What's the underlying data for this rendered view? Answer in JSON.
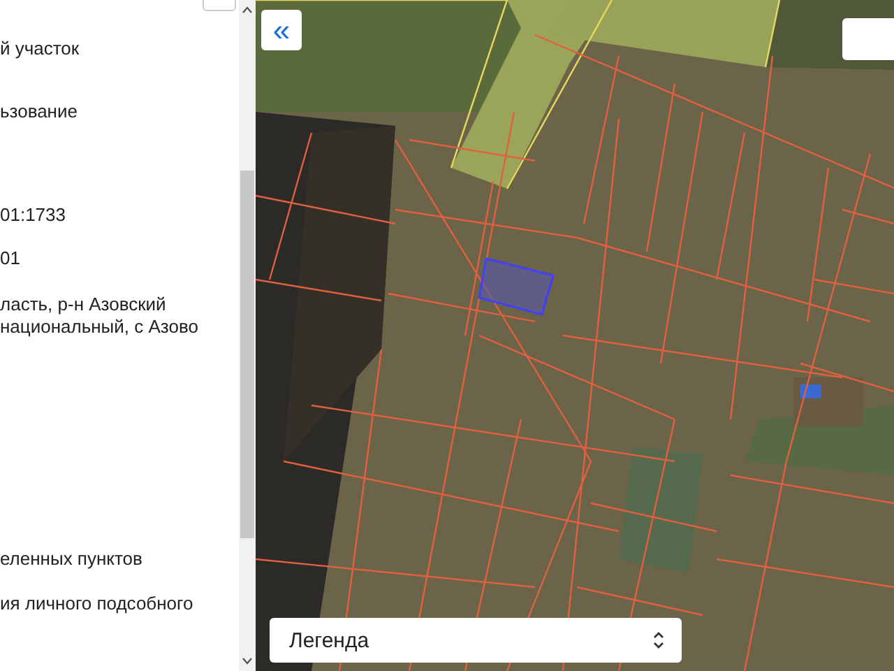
{
  "panel": {
    "items": [
      {
        "text": "й участок"
      },
      {
        "text": "ьзование"
      },
      {
        "text": "01:1733"
      },
      {
        "text": "01"
      },
      {
        "text": "ласть, р-н Азовский\nнациональный, с Азово"
      },
      {
        "text": "еленных пунктов"
      },
      {
        "text": "ия личного подсобного"
      }
    ]
  },
  "map": {
    "collapse_button": "«"
  },
  "legend_select": {
    "value": "Легенда"
  }
}
